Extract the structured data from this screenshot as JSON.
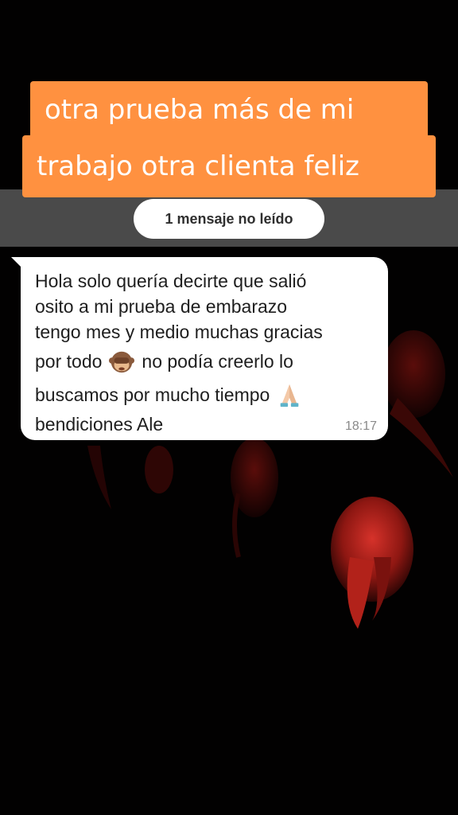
{
  "caption": {
    "line1": "otra prueba más de mi",
    "line2": "trabajo otra clienta feliz"
  },
  "unread_banner": "1 mensaje no leído",
  "message": {
    "lines": [
      "Hola solo quería decirte que salió",
      "osito a mi prueba de embarazo",
      "tengo mes y medio muchas gracias",
      "por todo",
      "no podía creerlo lo",
      "buscamos por mucho tiempo",
      "bendiciones Ale"
    ],
    "time": "18:17",
    "emoji_1": "see-no-evil-monkey-icon",
    "emoji_2": "praying-hands-icon"
  },
  "colors": {
    "caption_bg": "#ff9140",
    "band": "#4a4a4a",
    "bubble": "#ffffff",
    "background": "#020101"
  }
}
